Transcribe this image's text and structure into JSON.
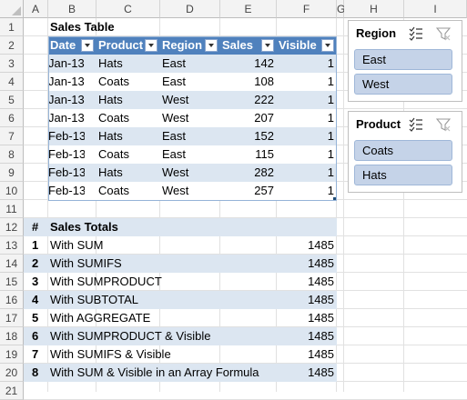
{
  "columns": [
    "A",
    "B",
    "C",
    "D",
    "E",
    "F",
    "G",
    "H",
    "I"
  ],
  "rows": [
    "1",
    "2",
    "3",
    "4",
    "5",
    "6",
    "7",
    "8",
    "9",
    "10",
    "11",
    "12",
    "13",
    "14",
    "15",
    "16",
    "17",
    "18",
    "19",
    "20",
    "21"
  ],
  "sales_table": {
    "title": "Sales Table",
    "headers": [
      "Date",
      "Product",
      "Region",
      "Sales",
      "Visible"
    ],
    "rows": [
      [
        "Jan-13",
        "Hats",
        "East",
        "142",
        "1"
      ],
      [
        "Jan-13",
        "Coats",
        "East",
        "108",
        "1"
      ],
      [
        "Jan-13",
        "Hats",
        "West",
        "222",
        "1"
      ],
      [
        "Jan-13",
        "Coats",
        "West",
        "207",
        "1"
      ],
      [
        "Feb-13",
        "Hats",
        "East",
        "152",
        "1"
      ],
      [
        "Feb-13",
        "Coats",
        "East",
        "115",
        "1"
      ],
      [
        "Feb-13",
        "Hats",
        "West",
        "282",
        "1"
      ],
      [
        "Feb-13",
        "Coats",
        "West",
        "257",
        "1"
      ]
    ]
  },
  "totals": {
    "hash_header": "#",
    "title": "Sales Totals",
    "rows": [
      [
        "1",
        "With SUM",
        "1485"
      ],
      [
        "2",
        "With SUMIFS",
        "1485"
      ],
      [
        "3",
        "With SUMPRODUCT",
        "1485"
      ],
      [
        "4",
        "With SUBTOTAL",
        "1485"
      ],
      [
        "5",
        "With AGGREGATE",
        "1485"
      ],
      [
        "6",
        "With SUMPRODUCT & Visible",
        "1485"
      ],
      [
        "7",
        "With SUMIFS & Visible",
        "1485"
      ],
      [
        "8",
        "With SUM & Visible in an Array Formula",
        "1485"
      ]
    ]
  },
  "slicers": {
    "region": {
      "title": "Region",
      "items": [
        "East",
        "West"
      ]
    },
    "product": {
      "title": "Product",
      "items": [
        "Coats",
        "Hats"
      ]
    }
  },
  "colors": {
    "table_header": "#4f81bd",
    "band": "#dce6f1",
    "slicer_item": "#c5d3e8"
  }
}
